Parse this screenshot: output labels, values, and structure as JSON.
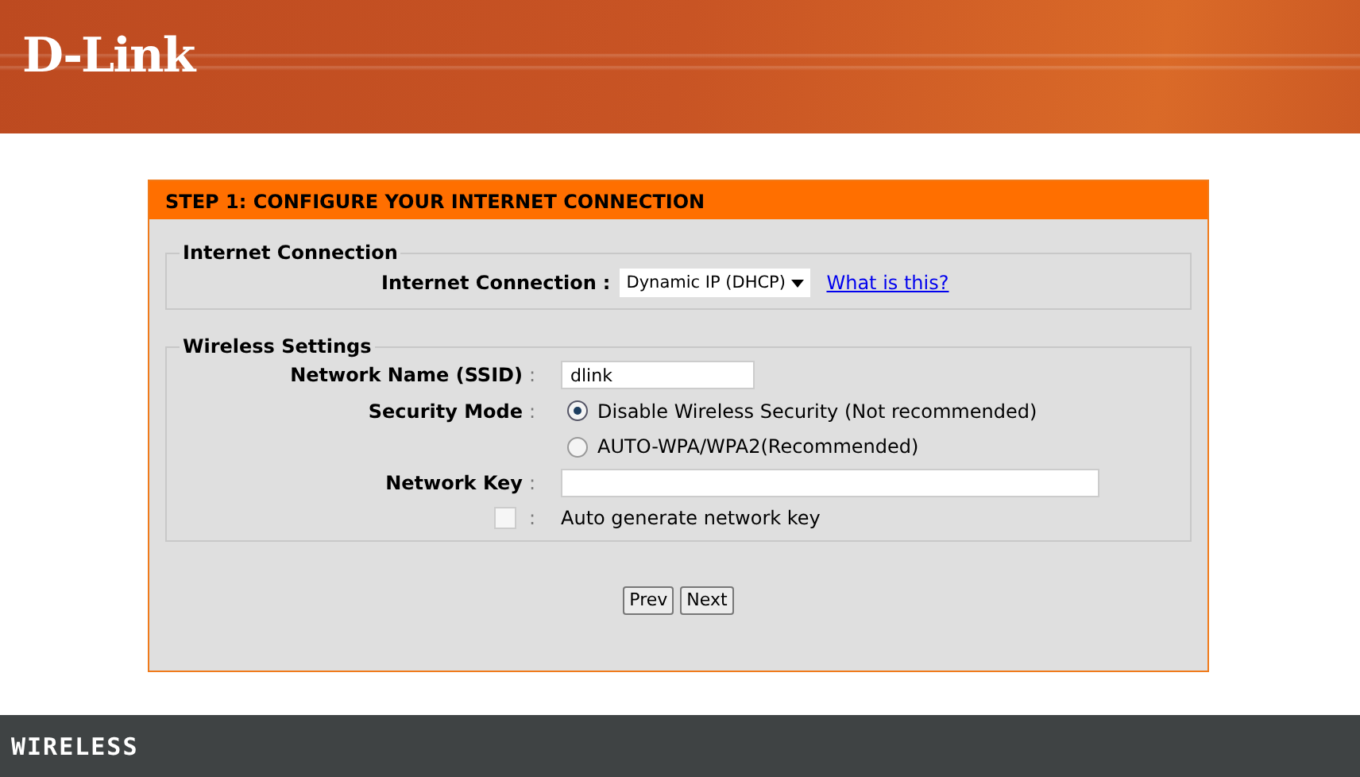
{
  "header": {
    "logo": "D-Link"
  },
  "wizard": {
    "title": "STEP 1: CONFIGURE YOUR INTERNET CONNECTION",
    "internet_connection": {
      "legend": "Internet Connection",
      "label": "Internet Connection",
      "colon": ":",
      "value": "Dynamic IP (DHCP)",
      "help_link": "What is this?"
    },
    "wireless_settings": {
      "legend": "Wireless Settings",
      "fields": [
        {
          "kind": "text",
          "label": "Network Name (SSID)",
          "colon": ":",
          "value": "dlink"
        },
        {
          "kind": "radio",
          "label": "Security Mode",
          "colon": ":",
          "options": [
            {
              "label": "Disable Wireless Security (Not recommended)",
              "selected": true
            },
            {
              "label": "AUTO-WPA/WPA2(Recommended)",
              "selected": false
            }
          ]
        },
        {
          "kind": "long_text",
          "label": "Network Key",
          "colon": ":"
        },
        {
          "kind": "checkbox",
          "checked": false,
          "colon": ":",
          "text": "Auto generate network key"
        }
      ]
    },
    "buttons": [
      "Prev",
      "Next"
    ]
  },
  "footer": {
    "brand": "WIRELESS"
  }
}
